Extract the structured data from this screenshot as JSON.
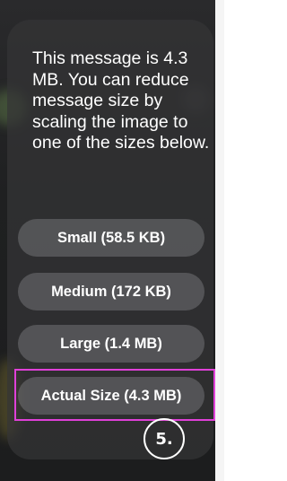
{
  "dialog": {
    "message": "This message is 4.3 MB. You can reduce message size by scaling the image to one of the sizes below.",
    "options": [
      {
        "label": "Small (58.5 KB)"
      },
      {
        "label": "Medium (172 KB)"
      },
      {
        "label": "Large (1.4 MB)"
      },
      {
        "label": "Actual Size (4.3 MB)"
      }
    ]
  },
  "annotation": {
    "step_label": "5.",
    "highlight_color": "#e040d8"
  }
}
